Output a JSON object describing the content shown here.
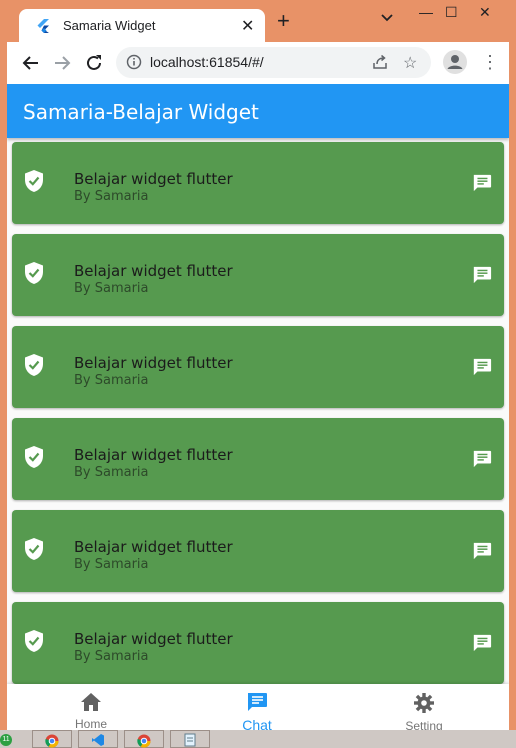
{
  "browser": {
    "tab_title": "Samaria Widget",
    "tab_close": "✕",
    "new_tab": "+",
    "url": "localhost:61854/#/",
    "minimize": "—",
    "maximize": "☐",
    "close": "✕"
  },
  "app": {
    "title": "Samaria-Belajar Widget",
    "primary_color": "#2196f3",
    "card_color": "#569a4f",
    "items": [
      {
        "title": "Belajar widget flutter",
        "subtitle": "By Samaria",
        "leading_icon": "shield-check-icon",
        "trailing_icon": "chat-icon"
      },
      {
        "title": "Belajar widget flutter",
        "subtitle": "By Samaria",
        "leading_icon": "shield-check-icon",
        "trailing_icon": "chat-icon"
      },
      {
        "title": "Belajar widget flutter",
        "subtitle": "By Samaria",
        "leading_icon": "shield-check-icon",
        "trailing_icon": "chat-icon"
      },
      {
        "title": "Belajar widget flutter",
        "subtitle": "By Samaria",
        "leading_icon": "shield-check-icon",
        "trailing_icon": "chat-icon"
      },
      {
        "title": "Belajar widget flutter",
        "subtitle": "By Samaria",
        "leading_icon": "shield-check-icon",
        "trailing_icon": "chat-icon"
      },
      {
        "title": "Belajar widget flutter",
        "subtitle": "By Samaria",
        "leading_icon": "shield-check-icon",
        "trailing_icon": "chat-icon"
      }
    ],
    "bottom_nav": {
      "items": [
        {
          "label": "Home",
          "icon": "home-icon"
        },
        {
          "label": "Chat",
          "icon": "chat-icon"
        },
        {
          "label": "Setting",
          "icon": "gear-icon"
        }
      ],
      "selected_index": 1,
      "selected_color": "#2196f3",
      "unselected_color": "#757575"
    }
  },
  "taskbar": {
    "badge": "11"
  }
}
